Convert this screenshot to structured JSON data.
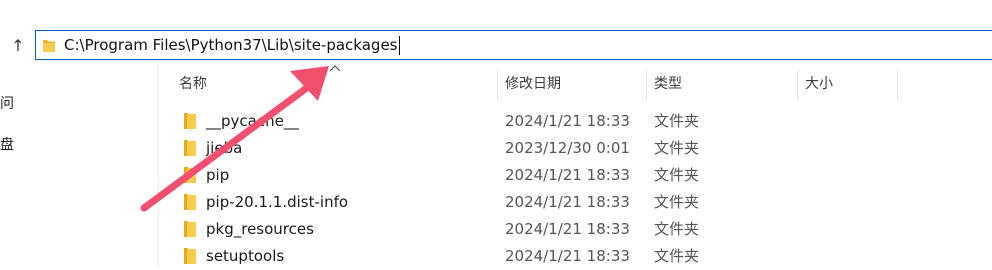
{
  "address_bar": {
    "path": "C:\\Program Files\\Python37\\Lib\\site-packages"
  },
  "left_pane": {
    "items": [
      "问",
      "盘"
    ]
  },
  "columns": {
    "name": "名称",
    "date": "修改日期",
    "type": "类型",
    "size": "大小"
  },
  "files": [
    {
      "name": "__pycache__",
      "date": "2024/1/21 18:33",
      "type": "文件夹"
    },
    {
      "name": "jieba",
      "date": "2023/12/30 0:01",
      "type": "文件夹"
    },
    {
      "name": "pip",
      "date": "2024/1/21 18:33",
      "type": "文件夹"
    },
    {
      "name": "pip-20.1.1.dist-info",
      "date": "2024/1/21 18:33",
      "type": "文件夹"
    },
    {
      "name": "pkg_resources",
      "date": "2024/1/21 18:33",
      "type": "文件夹"
    },
    {
      "name": "setuptools",
      "date": "2024/1/21 18:33",
      "type": "文件夹"
    }
  ],
  "colors": {
    "address_border": "#0a64c8",
    "folder": "#f4c542",
    "arrow": "#f0506e"
  },
  "icons": {
    "up": "up-arrow-icon",
    "folder": "folder-icon",
    "sort": "sort-caret-icon"
  }
}
